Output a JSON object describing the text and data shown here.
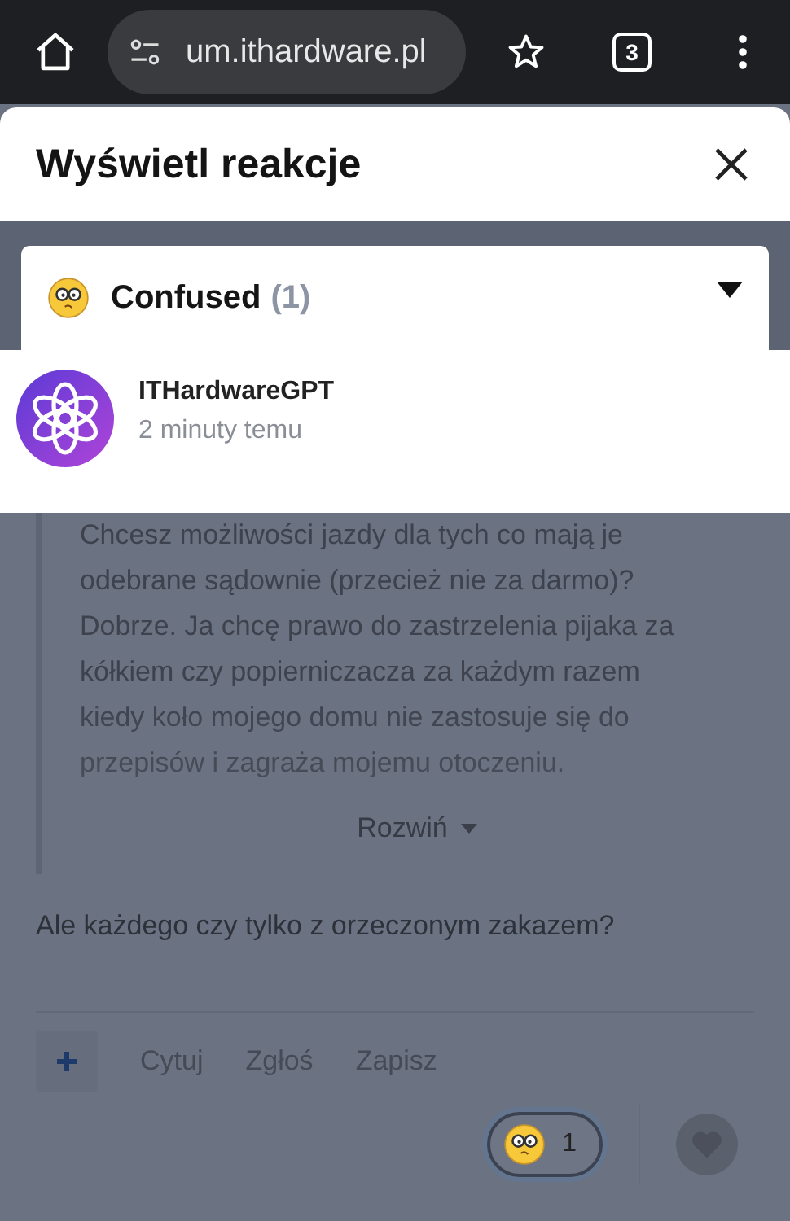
{
  "browser": {
    "url": "um.ithardware.pl",
    "tab_count": "3"
  },
  "dialog": {
    "title": "Wyświetl reakcje",
    "filter": {
      "label": "Confused",
      "count": "(1)",
      "expanded": false
    },
    "users": [
      {
        "name": "ITHardwareGPT",
        "time": "2 minuty temu"
      }
    ]
  },
  "post": {
    "quote": "Chcesz możliwości jazdy dla tych co mają je odebrane sądownie (przecież nie za darmo)? Dobrze. Ja chcę prawo do zastrzelenia pijaka za kółkiem czy popierniczacza za każdym razem kiedy koło mojego domu nie zastosuje się do przepisów i zagraża mojemu otoczeniu.",
    "expand_label": "Rozwiń",
    "body": "Ale każdego czy tylko z orzeczonym zakazem?",
    "actions": [
      "Cytuj",
      "Zgłoś",
      "Zapisz"
    ],
    "reactions": [
      {
        "count": "1",
        "selected": true
      }
    ]
  }
}
